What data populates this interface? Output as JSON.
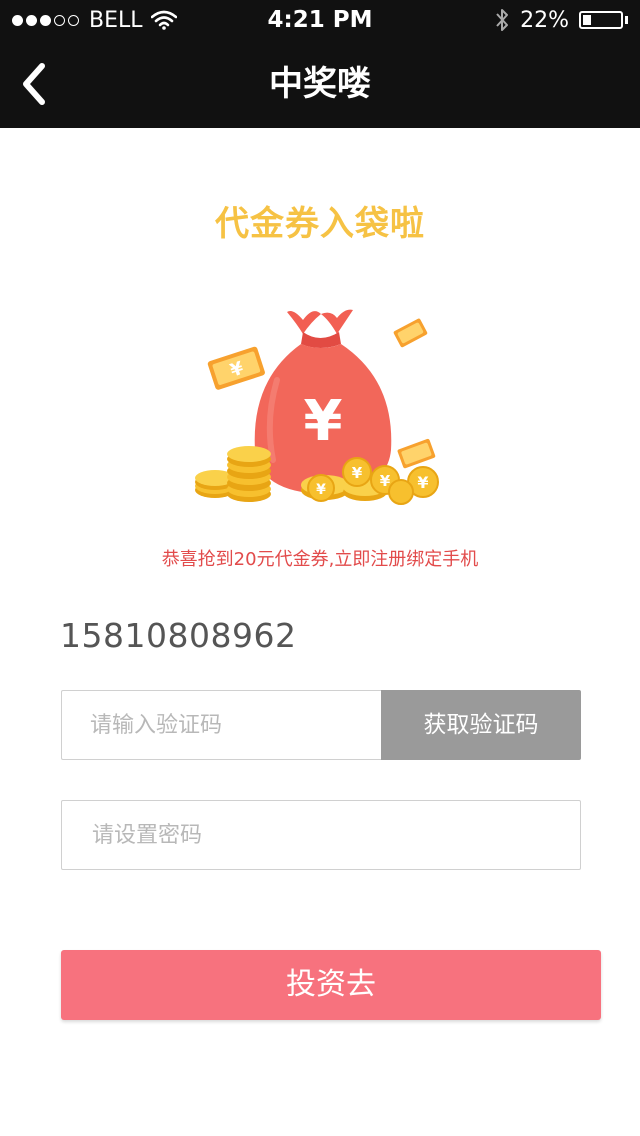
{
  "status_bar": {
    "carrier": "BELL",
    "time": "4:21 PM",
    "battery": "22%",
    "battery_level": 0.22,
    "signal_bars_filled": 3,
    "signal_bars_total": 5
  },
  "nav": {
    "title": "中奖喽",
    "back_icon": "chevron-left-icon"
  },
  "main": {
    "headline": "代金券入袋啦",
    "illustration": "money-bag-with-coins",
    "bag_symbol": "¥",
    "subtitle": "恭喜抢到20元代金券,立即注册绑定手机",
    "phone_number": "15810808962"
  },
  "form": {
    "code_placeholder": "请输入验证码",
    "code_value": "",
    "get_code_label": "获取验证码",
    "password_placeholder": "请设置密码",
    "password_value": ""
  },
  "actions": {
    "invest_label": "投资去"
  },
  "colors": {
    "nav_bg": "#111111",
    "headline": "#f6c244",
    "subtitle": "#e24b4b",
    "code_button": "#9a9a9a",
    "primary_button": "#f7727e"
  }
}
